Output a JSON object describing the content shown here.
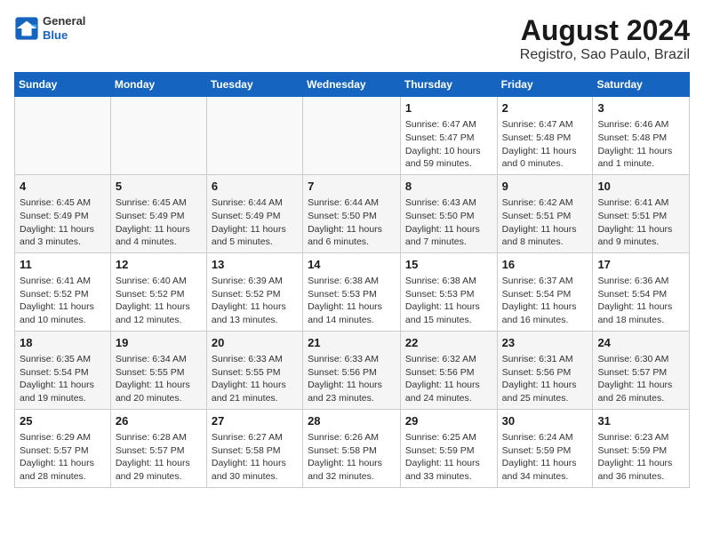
{
  "header": {
    "logo_general": "General",
    "logo_blue": "Blue",
    "title": "August 2024",
    "subtitle": "Registro, Sao Paulo, Brazil"
  },
  "days_of_week": [
    "Sunday",
    "Monday",
    "Tuesday",
    "Wednesday",
    "Thursday",
    "Friday",
    "Saturday"
  ],
  "weeks": [
    [
      {
        "day": "",
        "content": ""
      },
      {
        "day": "",
        "content": ""
      },
      {
        "day": "",
        "content": ""
      },
      {
        "day": "",
        "content": ""
      },
      {
        "day": "1",
        "content": "Sunrise: 6:47 AM\nSunset: 5:47 PM\nDaylight: 10 hours\nand 59 minutes."
      },
      {
        "day": "2",
        "content": "Sunrise: 6:47 AM\nSunset: 5:48 PM\nDaylight: 11 hours\nand 0 minutes."
      },
      {
        "day": "3",
        "content": "Sunrise: 6:46 AM\nSunset: 5:48 PM\nDaylight: 11 hours\nand 1 minute."
      }
    ],
    [
      {
        "day": "4",
        "content": "Sunrise: 6:45 AM\nSunset: 5:49 PM\nDaylight: 11 hours\nand 3 minutes."
      },
      {
        "day": "5",
        "content": "Sunrise: 6:45 AM\nSunset: 5:49 PM\nDaylight: 11 hours\nand 4 minutes."
      },
      {
        "day": "6",
        "content": "Sunrise: 6:44 AM\nSunset: 5:49 PM\nDaylight: 11 hours\nand 5 minutes."
      },
      {
        "day": "7",
        "content": "Sunrise: 6:44 AM\nSunset: 5:50 PM\nDaylight: 11 hours\nand 6 minutes."
      },
      {
        "day": "8",
        "content": "Sunrise: 6:43 AM\nSunset: 5:50 PM\nDaylight: 11 hours\nand 7 minutes."
      },
      {
        "day": "9",
        "content": "Sunrise: 6:42 AM\nSunset: 5:51 PM\nDaylight: 11 hours\nand 8 minutes."
      },
      {
        "day": "10",
        "content": "Sunrise: 6:41 AM\nSunset: 5:51 PM\nDaylight: 11 hours\nand 9 minutes."
      }
    ],
    [
      {
        "day": "11",
        "content": "Sunrise: 6:41 AM\nSunset: 5:52 PM\nDaylight: 11 hours\nand 10 minutes."
      },
      {
        "day": "12",
        "content": "Sunrise: 6:40 AM\nSunset: 5:52 PM\nDaylight: 11 hours\nand 12 minutes."
      },
      {
        "day": "13",
        "content": "Sunrise: 6:39 AM\nSunset: 5:52 PM\nDaylight: 11 hours\nand 13 minutes."
      },
      {
        "day": "14",
        "content": "Sunrise: 6:38 AM\nSunset: 5:53 PM\nDaylight: 11 hours\nand 14 minutes."
      },
      {
        "day": "15",
        "content": "Sunrise: 6:38 AM\nSunset: 5:53 PM\nDaylight: 11 hours\nand 15 minutes."
      },
      {
        "day": "16",
        "content": "Sunrise: 6:37 AM\nSunset: 5:54 PM\nDaylight: 11 hours\nand 16 minutes."
      },
      {
        "day": "17",
        "content": "Sunrise: 6:36 AM\nSunset: 5:54 PM\nDaylight: 11 hours\nand 18 minutes."
      }
    ],
    [
      {
        "day": "18",
        "content": "Sunrise: 6:35 AM\nSunset: 5:54 PM\nDaylight: 11 hours\nand 19 minutes."
      },
      {
        "day": "19",
        "content": "Sunrise: 6:34 AM\nSunset: 5:55 PM\nDaylight: 11 hours\nand 20 minutes."
      },
      {
        "day": "20",
        "content": "Sunrise: 6:33 AM\nSunset: 5:55 PM\nDaylight: 11 hours\nand 21 minutes."
      },
      {
        "day": "21",
        "content": "Sunrise: 6:33 AM\nSunset: 5:56 PM\nDaylight: 11 hours\nand 23 minutes."
      },
      {
        "day": "22",
        "content": "Sunrise: 6:32 AM\nSunset: 5:56 PM\nDaylight: 11 hours\nand 24 minutes."
      },
      {
        "day": "23",
        "content": "Sunrise: 6:31 AM\nSunset: 5:56 PM\nDaylight: 11 hours\nand 25 minutes."
      },
      {
        "day": "24",
        "content": "Sunrise: 6:30 AM\nSunset: 5:57 PM\nDaylight: 11 hours\nand 26 minutes."
      }
    ],
    [
      {
        "day": "25",
        "content": "Sunrise: 6:29 AM\nSunset: 5:57 PM\nDaylight: 11 hours\nand 28 minutes."
      },
      {
        "day": "26",
        "content": "Sunrise: 6:28 AM\nSunset: 5:57 PM\nDaylight: 11 hours\nand 29 minutes."
      },
      {
        "day": "27",
        "content": "Sunrise: 6:27 AM\nSunset: 5:58 PM\nDaylight: 11 hours\nand 30 minutes."
      },
      {
        "day": "28",
        "content": "Sunrise: 6:26 AM\nSunset: 5:58 PM\nDaylight: 11 hours\nand 32 minutes."
      },
      {
        "day": "29",
        "content": "Sunrise: 6:25 AM\nSunset: 5:59 PM\nDaylight: 11 hours\nand 33 minutes."
      },
      {
        "day": "30",
        "content": "Sunrise: 6:24 AM\nSunset: 5:59 PM\nDaylight: 11 hours\nand 34 minutes."
      },
      {
        "day": "31",
        "content": "Sunrise: 6:23 AM\nSunset: 5:59 PM\nDaylight: 11 hours\nand 36 minutes."
      }
    ]
  ]
}
